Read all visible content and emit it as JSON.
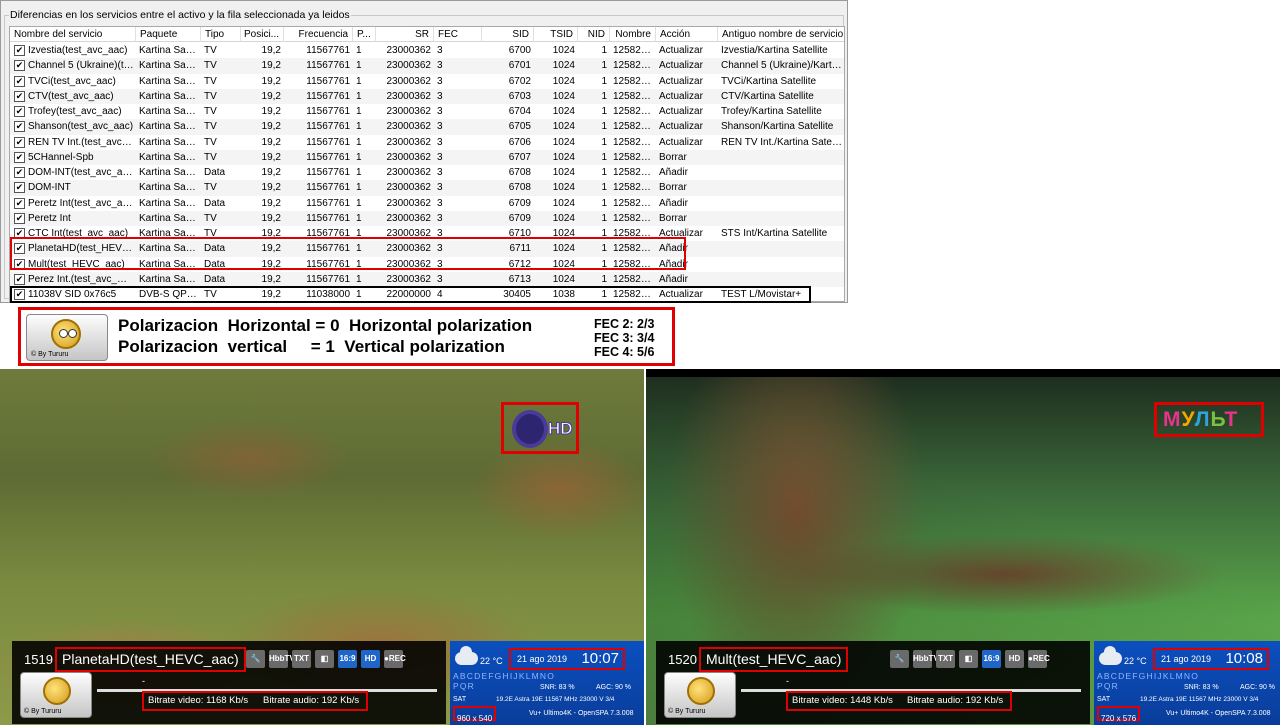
{
  "table_panel": {
    "legend": "Diferencias en los servicios entre el activo y la fila seleccionada ya leidos",
    "columns": [
      "Nombre del servicio",
      "Paquete",
      "Tipo",
      "Posici...",
      "Frecuencia",
      "P...",
      "SR",
      "FEC",
      "SID",
      "TSID",
      "NID",
      "Nombre",
      "Acción",
      "Antiguo nombre de servicio ..."
    ],
    "check_mark": "✔",
    "rows": [
      [
        "Izvestia(test_avc_aac)",
        "Kartina Satell...",
        "TV",
        "19,2",
        "11567761",
        "1",
        "23000362",
        "3",
        "6700",
        "1024",
        "1",
        "12582912",
        "Actualizar",
        "Izvestia/Kartina Satellite"
      ],
      [
        "Channel 5 (Ukraine)(tes...",
        "Kartina Satell...",
        "TV",
        "19,2",
        "11567761",
        "1",
        "23000362",
        "3",
        "6701",
        "1024",
        "1",
        "12582912",
        "Actualizar",
        "Channel 5 (Ukraine)/Kartina ..."
      ],
      [
        "TVCi(test_avc_aac)",
        "Kartina Satell...",
        "TV",
        "19,2",
        "11567761",
        "1",
        "23000362",
        "3",
        "6702",
        "1024",
        "1",
        "12582912",
        "Actualizar",
        "TVCi/Kartina Satellite"
      ],
      [
        "CTV(test_avc_aac)",
        "Kartina Satell...",
        "TV",
        "19,2",
        "11567761",
        "1",
        "23000362",
        "3",
        "6703",
        "1024",
        "1",
        "12582912",
        "Actualizar",
        "CTV/Kartina Satellite"
      ],
      [
        "Trofey(test_avc_aac)",
        "Kartina Satell...",
        "TV",
        "19,2",
        "11567761",
        "1",
        "23000362",
        "3",
        "6704",
        "1024",
        "1",
        "12582912",
        "Actualizar",
        "Trofey/Kartina Satellite"
      ],
      [
        "Shanson(test_avc_aac)",
        "Kartina Satell...",
        "TV",
        "19,2",
        "11567761",
        "1",
        "23000362",
        "3",
        "6705",
        "1024",
        "1",
        "12582912",
        "Actualizar",
        "Shanson/Kartina Satellite"
      ],
      [
        "REN TV Int.(test_avc_...",
        "Kartina Satell...",
        "TV",
        "19,2",
        "11567761",
        "1",
        "23000362",
        "3",
        "6706",
        "1024",
        "1",
        "12582912",
        "Actualizar",
        "REN TV Int./Kartina Satellite"
      ],
      [
        "5CHannel-Spb",
        "Kartina Satell...",
        "TV",
        "19,2",
        "11567761",
        "1",
        "23000362",
        "3",
        "6707",
        "1024",
        "1",
        "12582912",
        "Borrar",
        ""
      ],
      [
        "DOM-INT(test_avc_aac)",
        "Kartina Satell...",
        "Data",
        "19,2",
        "11567761",
        "1",
        "23000362",
        "3",
        "6708",
        "1024",
        "1",
        "12582912",
        "Añadir",
        ""
      ],
      [
        "DOM-INT",
        "Kartina Satell...",
        "TV",
        "19,2",
        "11567761",
        "1",
        "23000362",
        "3",
        "6708",
        "1024",
        "1",
        "12582912",
        "Borrar",
        ""
      ],
      [
        "Peretz Int(test_avc_aac)",
        "Kartina Satell...",
        "Data",
        "19,2",
        "11567761",
        "1",
        "23000362",
        "3",
        "6709",
        "1024",
        "1",
        "12582912",
        "Añadir",
        ""
      ],
      [
        "Peretz Int",
        "Kartina Satell...",
        "TV",
        "19,2",
        "11567761",
        "1",
        "23000362",
        "3",
        "6709",
        "1024",
        "1",
        "12582912",
        "Borrar",
        ""
      ],
      [
        "CTC Int(test_avc_aac)",
        "Kartina Satell...",
        "TV",
        "19,2",
        "11567761",
        "1",
        "23000362",
        "3",
        "6710",
        "1024",
        "1",
        "12582912",
        "Actualizar",
        "STS Int/Kartina Satellite"
      ],
      [
        "PlanetaHD(test_HEVC_...",
        "Kartina Satell...",
        "Data",
        "19,2",
        "11567761",
        "1",
        "23000362",
        "3",
        "6711",
        "1024",
        "1",
        "12582912",
        "Añadir",
        ""
      ],
      [
        "Mult(test_HEVC_aac)",
        "Kartina Satell...",
        "Data",
        "19,2",
        "11567761",
        "1",
        "23000362",
        "3",
        "6712",
        "1024",
        "1",
        "12582912",
        "Añadir",
        ""
      ],
      [
        "Perez Int.(test_avc_mp...",
        "Kartina Satell...",
        "Data",
        "19,2",
        "11567761",
        "1",
        "23000362",
        "3",
        "6713",
        "1024",
        "1",
        "12582912",
        "Añadir",
        ""
      ],
      [
        "11038V SID 0x76c5",
        "DVB-S QPS...",
        "TV",
        "19,2",
        "11038000",
        "1",
        "22000000",
        "4",
        "30405",
        "1038",
        "1",
        "12582912",
        "Actualizar",
        "TEST L/Movistar+"
      ]
    ]
  },
  "banner": {
    "by_label": "© By Tururu",
    "line1": "Polarizacion  Horizontal = 0  Horizontal polarization",
    "line2": "Polarizacion  vertical     = 1  Vertical polarization",
    "fec": [
      "FEC 2: 2/3",
      "FEC 3: 3/4",
      "FEC 4: 5/6"
    ]
  },
  "left_screen": {
    "logo_text": "HD",
    "channel_number": "1519",
    "channel_name": "PlanetaHD(test_HEVC_aac)",
    "icons": [
      "wrench-icon",
      "HbbTV",
      "TXT",
      "dolby-icon",
      "16:9",
      "HD",
      "●REC"
    ],
    "dash": "-",
    "bitrate_video": "Bitrate video:  1168 Kb/s",
    "bitrate_audio": "Bitrate audio:  192 Kb/s",
    "temperature": "22 °C",
    "date": "21 ago 2019",
    "time": "10:07",
    "alphabet": "ABCDEFGHIJKLMNOPQR",
    "snr": "SNR:  83 %",
    "agc": "AGC:  90 %",
    "sat_label": "SAT",
    "sat_info": "19.2E Astra 19E 11567 MHz 23000 V 3/4",
    "resolution": "960 x 540",
    "receiver": "Vu+ Ultimo4K - OpenSPA 7.3.008",
    "by_label": "© By Tururu"
  },
  "right_screen": {
    "logo_text": "МУЛЬТ",
    "channel_number": "1520",
    "channel_name": "Mult(test_HEVC_aac)",
    "icons": [
      "wrench-icon",
      "HbbTV",
      "TXT",
      "dolby-icon",
      "16:9",
      "HD",
      "●REC"
    ],
    "dash": "-",
    "bitrate_video": "Bitrate video:  1448 Kb/s",
    "bitrate_audio": "Bitrate audio:  192 Kb/s",
    "temperature": "22 °C",
    "date": "21 ago 2019",
    "time": "10:08",
    "alphabet": "ABCDEFGHIJKLMNOPQR",
    "snr": "SNR:  83 %",
    "agc": "AGC:  90 %",
    "sat_label": "SAT",
    "sat_info": "19.2E Astra 19E 11567 MHz 23000 V 3/4",
    "resolution": "720 x 576",
    "receiver": "Vu+ Ultimo4K - OpenSPA 7.3.008",
    "by_label": "© By Tururu"
  },
  "colors": {
    "highlight": "#e00000",
    "info_blue": "#0b4fbf",
    "mult_colors": [
      "#e8338a",
      "#f6a800",
      "#2aa5e0",
      "#7ac143",
      "#e8338a"
    ]
  }
}
